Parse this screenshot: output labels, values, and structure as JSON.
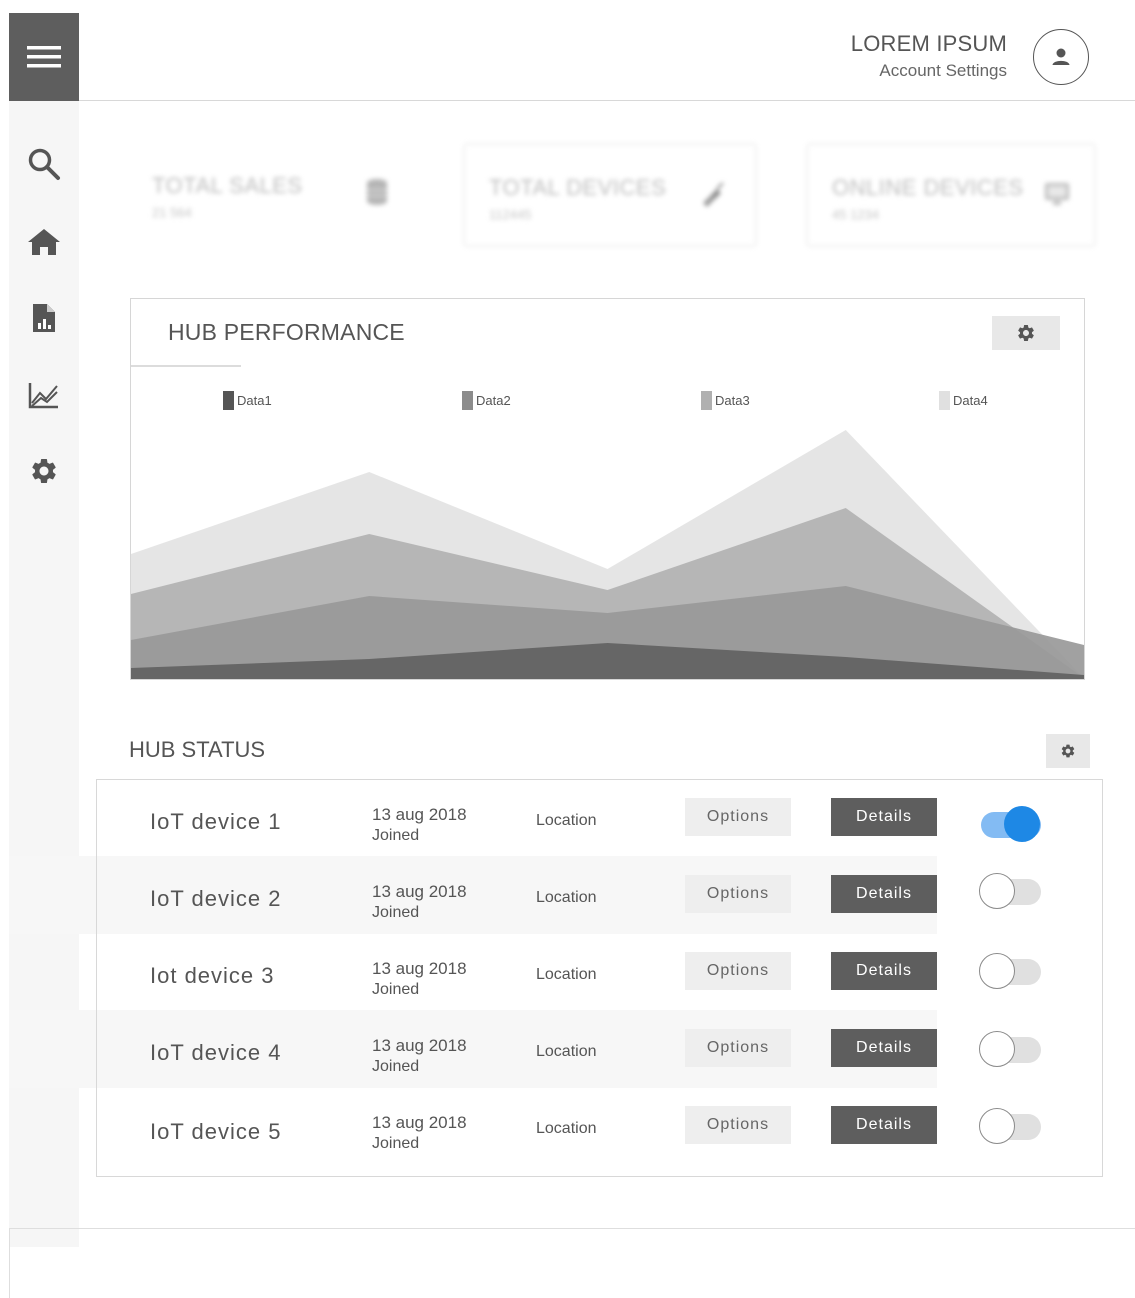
{
  "header": {
    "user_name": "LOREM IPSUM",
    "account_settings": "Account Settings"
  },
  "sidebar": {
    "items": [
      {
        "icon": "menu-icon"
      },
      {
        "icon": "search-icon"
      },
      {
        "icon": "home-icon"
      },
      {
        "icon": "report-icon"
      },
      {
        "icon": "analytics-icon"
      },
      {
        "icon": "gear-icon"
      }
    ]
  },
  "kpis": [
    {
      "title": "TOTAL SALES",
      "value": "21 564",
      "icon": "database-icon"
    },
    {
      "title": "TOTAL DEVICES",
      "value": "112445",
      "icon": "plug-icon"
    },
    {
      "title": "ONLINE DEVICES",
      "value": "45 1234",
      "icon": "monitor-icon"
    }
  ],
  "hub_performance": {
    "title": "HUB PERFORMANCE"
  },
  "chart_data": {
    "type": "area",
    "title": "HUB PERFORMANCE",
    "x": [
      0,
      1,
      2,
      3,
      4
    ],
    "series": [
      {
        "name": "Data1",
        "color": "#666666",
        "values": [
          12,
          21,
          37,
          23,
          5
        ]
      },
      {
        "name": "Data2",
        "color": "#999999",
        "values": [
          40,
          84,
          67,
          94,
          35
        ]
      },
      {
        "name": "Data3",
        "color": "#b2b2b2",
        "values": [
          86,
          146,
          90,
          172,
          2
        ]
      },
      {
        "name": "Data4",
        "color": "#e3e3e3",
        "values": [
          126,
          208,
          111,
          250,
          2
        ]
      }
    ],
    "ylim": [
      0,
      275
    ],
    "legend": "top",
    "grid": false
  },
  "hub_status": {
    "title": "HUB STATUS",
    "rows": [
      {
        "name": "IoT device 1",
        "date": "13 aug 2018",
        "joined": "Joined",
        "location": "Location",
        "options": "Options",
        "details": "Details",
        "enabled": true
      },
      {
        "name": "IoT device 2",
        "date": "13 aug 2018",
        "joined": "Joined",
        "location": "Location",
        "options": "Options",
        "details": "Details",
        "enabled": false
      },
      {
        "name": "Iot device 3",
        "date": "13 aug 2018",
        "joined": "Joined",
        "location": "Location",
        "options": "Options",
        "details": "Details",
        "enabled": false
      },
      {
        "name": "IoT device 4",
        "date": "13 aug 2018",
        "joined": "Joined",
        "location": "Location",
        "options": "Options",
        "details": "Details",
        "enabled": false
      },
      {
        "name": "IoT device 5",
        "date": "13 aug 2018",
        "joined": "Joined",
        "location": "Location",
        "options": "Options",
        "details": "Details",
        "enabled": false
      }
    ]
  }
}
